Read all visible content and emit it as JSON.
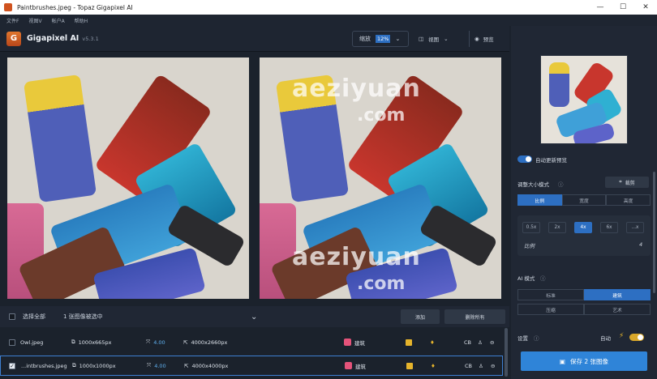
{
  "window": {
    "title": "Paintbrushes.jpeg - Topaz Gigapixel AI",
    "minimize": "—",
    "maximize": "☐",
    "close": "✕"
  },
  "menu": [
    "文件F",
    "视图V",
    "帐户A",
    "帮助H"
  ],
  "header": {
    "logo_letter": "G",
    "app_name": "Gigapixel AI",
    "version": "v5.3.1",
    "zoom_label": "缩放",
    "zoom_value": "12%",
    "view_label": "视图",
    "preview_label": "预览"
  },
  "watermark": {
    "text": "aeziyuan",
    "sub": ".com"
  },
  "selection": {
    "select_all": "选择全部",
    "count_text": "1 张图像被选中",
    "add_label": "添加",
    "remove_all_label": "删除所有"
  },
  "files": [
    {
      "name": "Owl.jpeg",
      "src_size": "1000x665px",
      "scale": "4.00",
      "out_size": "4000x2660px",
      "mode": "建筑",
      "format": "CB",
      "checked": false
    },
    {
      "name": "...intbrushes.jpeg",
      "src_size": "1000x1000px",
      "scale": "4.00",
      "out_size": "4000x4000px",
      "mode": "建筑",
      "format": "CB",
      "checked": true
    }
  ],
  "panel": {
    "auto_preview": "自动更新预览",
    "resize_mode": "调整大小模式",
    "crop_label": "裁剪",
    "resize_tabs": [
      "比例",
      "宽度",
      "高度"
    ],
    "scale_buttons": [
      "0.5x",
      "2x",
      "4x",
      "6x",
      "...x"
    ],
    "scale_label": "比例",
    "scale_value": "4",
    "ai_mode": "AI 模式",
    "ai_options": [
      "标准",
      "建筑",
      "压缩",
      "艺术"
    ],
    "settings": "设置",
    "auto_label": "自动",
    "save_label": "保存 2 张图像"
  }
}
